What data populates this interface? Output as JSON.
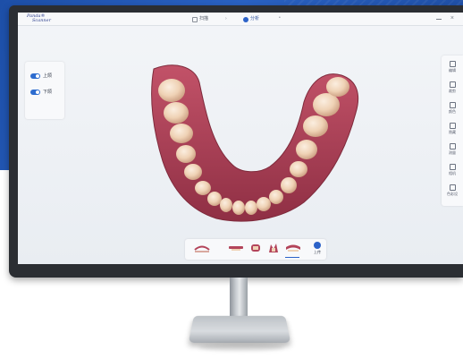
{
  "app": {
    "logo_line1": "Panda®",
    "logo_line2": "Scanner"
  },
  "titlebar": {
    "tabs": [
      {
        "label": "扫描",
        "active": false,
        "icon": "scan-icon"
      },
      {
        "label": "分析",
        "active": true,
        "icon": "analysis-icon"
      }
    ],
    "separator": "›",
    "more": "•",
    "close_glyph": "×"
  },
  "jaw_panel": {
    "items": [
      {
        "label": "上颌",
        "enabled": true
      },
      {
        "label": "下颌",
        "enabled": true
      }
    ]
  },
  "right_toolbar": {
    "items": [
      {
        "label": "编辑",
        "icon": "edit-icon"
      },
      {
        "label": "裁剪",
        "icon": "crop-icon"
      },
      {
        "label": "颜色",
        "icon": "color-icon"
      },
      {
        "label": "隐藏",
        "icon": "hide-icon"
      },
      {
        "label": "测量",
        "icon": "measure-icon"
      },
      {
        "label": "相机",
        "icon": "camera-icon"
      },
      {
        "label": "色彩设",
        "icon": "palette-icon"
      }
    ]
  },
  "bottom_toolbar": {
    "views": [
      {
        "icon": "upper-jaw-view-icon"
      },
      {
        "icon": "lower-jaw-view-icon"
      },
      {
        "icon": "front-view-icon"
      },
      {
        "icon": "side-view-icon"
      },
      {
        "icon": "occlusal-view-icon",
        "active": true
      }
    ],
    "export_label": "上传"
  },
  "colors": {
    "accent": "#2c62c8",
    "background_band": "#1d4fa8",
    "bezel": "#2b2e33",
    "gum": "#b3445a",
    "tooth": "#efd2b5"
  }
}
